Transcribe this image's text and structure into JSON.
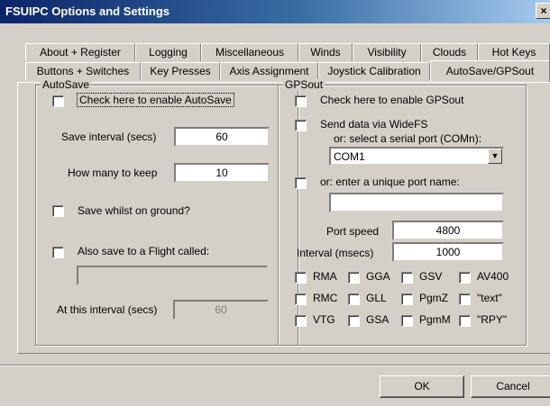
{
  "window": {
    "title": "FSUIPC Options and Settings",
    "close_glyph": "×"
  },
  "tabs": {
    "row1": [
      "About + Register",
      "Logging",
      "Miscellaneous",
      "Winds",
      "Visibility",
      "Clouds",
      "Hot Keys"
    ],
    "row2": [
      "Buttons + Switches",
      "Key Presses",
      "Axis Assignment",
      "Joystick Calibration",
      "AutoSave/GPSout"
    ],
    "active": "AutoSave/GPSout"
  },
  "autosave": {
    "legend": "AutoSave",
    "enable_label": "Check here to enable AutoSave",
    "save_interval_label": "Save interval (secs)",
    "save_interval_value": "60",
    "how_many_label": "How many to keep",
    "how_many_value": "10",
    "save_on_ground_label": "Save whilst on ground?",
    "also_save_label": "Also save to a Flight called:",
    "flight_name_value": "",
    "at_interval_label": "At this interval (secs)",
    "at_interval_value": "60"
  },
  "gpsout": {
    "legend": "GPSout",
    "enable_label": "Check here to enable GPSout",
    "widefs_label": "Send data via WideFS",
    "serial_label": "or: select a serial port (COMn):",
    "serial_value": "COM1",
    "unique_port_label": "or: enter a unique port name:",
    "unique_port_value": "",
    "port_speed_label": "Port speed",
    "port_speed_value": "4800",
    "interval_label": "Interval (msecs)",
    "interval_value": "1000",
    "sentences": [
      [
        "RMA",
        "GGA",
        "GSV",
        "AV400"
      ],
      [
        "RMC",
        "GLL",
        "PgmZ",
        "\"text\""
      ],
      [
        "VTG",
        "GSA",
        "PgmM",
        "\"RPY\""
      ]
    ]
  },
  "buttons": {
    "ok": "OK",
    "cancel": "Cancel"
  }
}
